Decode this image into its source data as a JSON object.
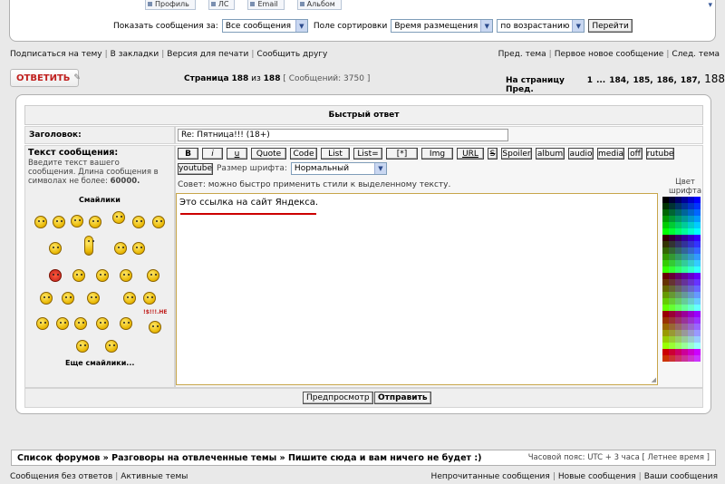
{
  "top_tabs": [
    "Профиль",
    "ЛС",
    "Email",
    "Альбом"
  ],
  "show_bar": {
    "show_label": "Показать сообщения за:",
    "show_value": "Все сообщения",
    "sort_label": "Поле сортировки",
    "sort_value": "Время размещения",
    "order_value": "по возрастанию",
    "go_label": "Перейти"
  },
  "topic_links": [
    "Подписаться на тему",
    "В закладки",
    "Версия для печати",
    "Сообщить другу"
  ],
  "nav_links": [
    "Пред. тема",
    "Первое новое сообщение",
    "След. тема"
  ],
  "reply_button": "ОТВЕТИТЬ",
  "page_info": {
    "prefix": "Страница",
    "current": "188",
    "of": "из",
    "total": "188",
    "count": "[ Сообщений: 3750 ]"
  },
  "pagination": {
    "label": "На страницу Пред.",
    "pages": [
      "1",
      "...",
      "184,",
      "185,",
      "186,",
      "187,"
    ],
    "current": "188"
  },
  "quick_reply": {
    "title": "Быстрый ответ",
    "subject_label": "Заголовок:",
    "subject_value": "Re: Пятница!!! (18+)",
    "message_label": "Текст сообщения:",
    "message_hint": "Введите текст вашего сообщения. Длина сообщения в символах не более:",
    "message_limit": "60000.",
    "smilies_title": "Смайлики",
    "more_smilies": "Еще смайлики...",
    "format_buttons": [
      "B",
      "i",
      "u",
      "Quote",
      "Code",
      "List",
      "List=",
      "[*]",
      "Img",
      "URL",
      "S",
      "Spoiler",
      "album",
      "audio",
      "media",
      "off",
      "rutube"
    ],
    "youtube_button": "youtube",
    "font_size_label": "Размер шрифта:",
    "font_size_value": "Нормальный",
    "tip": "Совет: можно быстро применить стили к выделенному тексту.",
    "message_text": "Это ссылка на сайт Яндекса.",
    "color_label": "Цвет шрифта",
    "preview_button": "Предпросмотр",
    "submit_button": "Отправить",
    "smiley_badge": "!$!!!.НЕ"
  },
  "breadcrumb": {
    "text": "Список форумов » Разговоры на отвлеченные темы » Пишите сюда и вам ничего не будет :)",
    "timezone": "Часовой пояс: UTC + 3 часа",
    "dst": "[ Летнее время ]"
  },
  "footer_left": [
    "Сообщения без ответов",
    "Активные темы"
  ],
  "footer_right": [
    "Непрочитанные сообщения",
    "Новые сообщения",
    "Ваши сообщения"
  ],
  "colors": {
    "accent_red": "#c0201e",
    "underline_red": "#cc0000",
    "textarea_border": "#c8a64a"
  }
}
